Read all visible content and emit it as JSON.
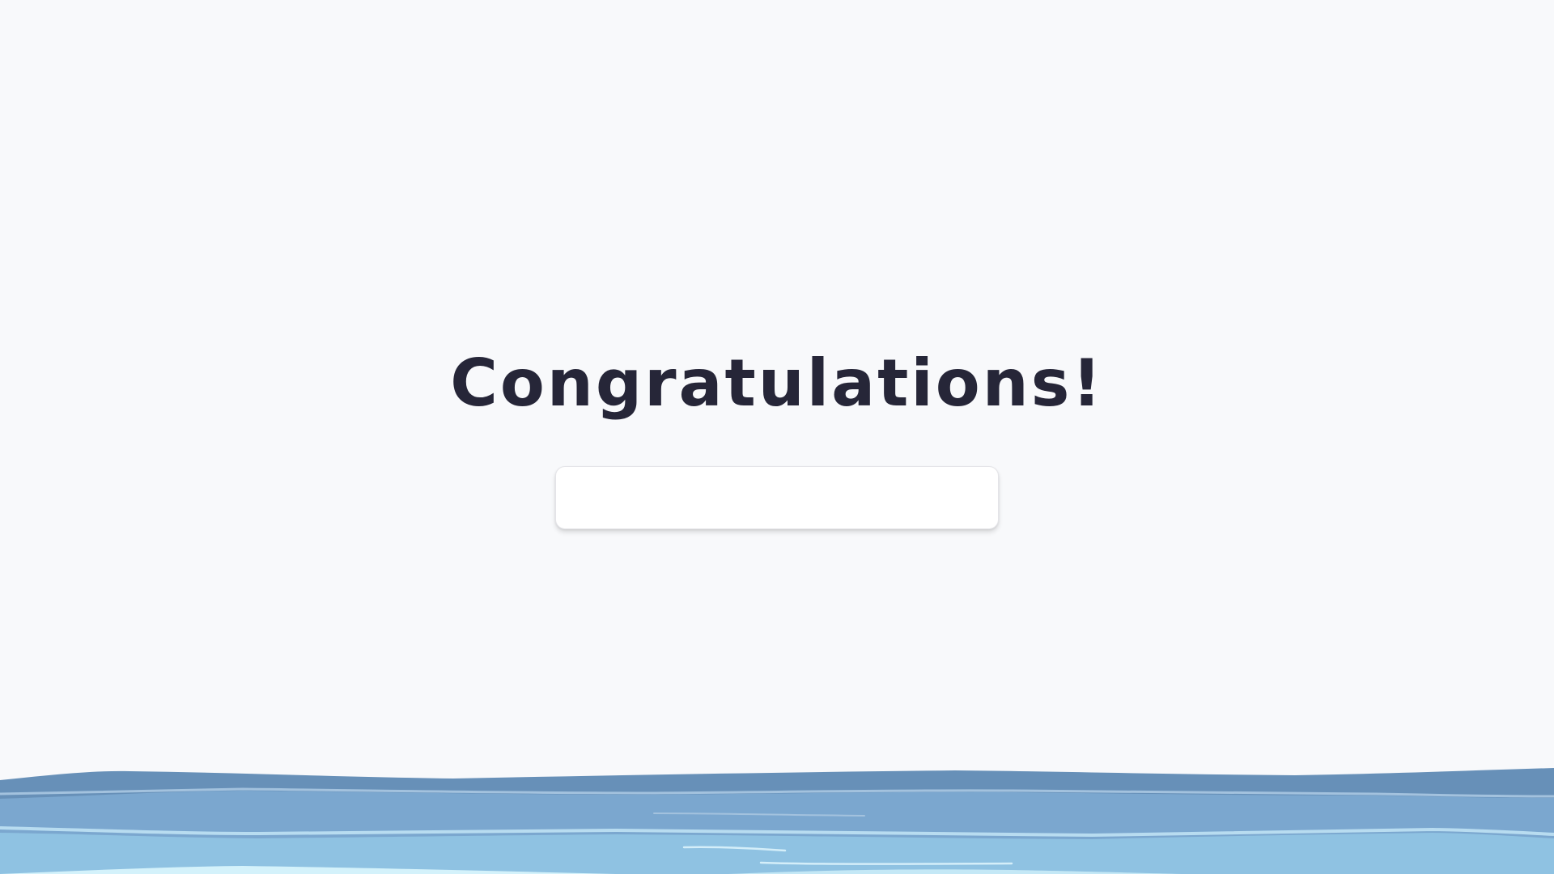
{
  "congrats": {
    "title": "Congratulations!",
    "name_input_value": "",
    "name_input_placeholder": ""
  },
  "colors": {
    "background": "#f8f9fb",
    "title_text": "#262638",
    "water_deep": "#6790b8",
    "water_mid": "#7ba7cf",
    "water_light": "#8fc2e2",
    "water_foam": "#d4f2fb"
  }
}
